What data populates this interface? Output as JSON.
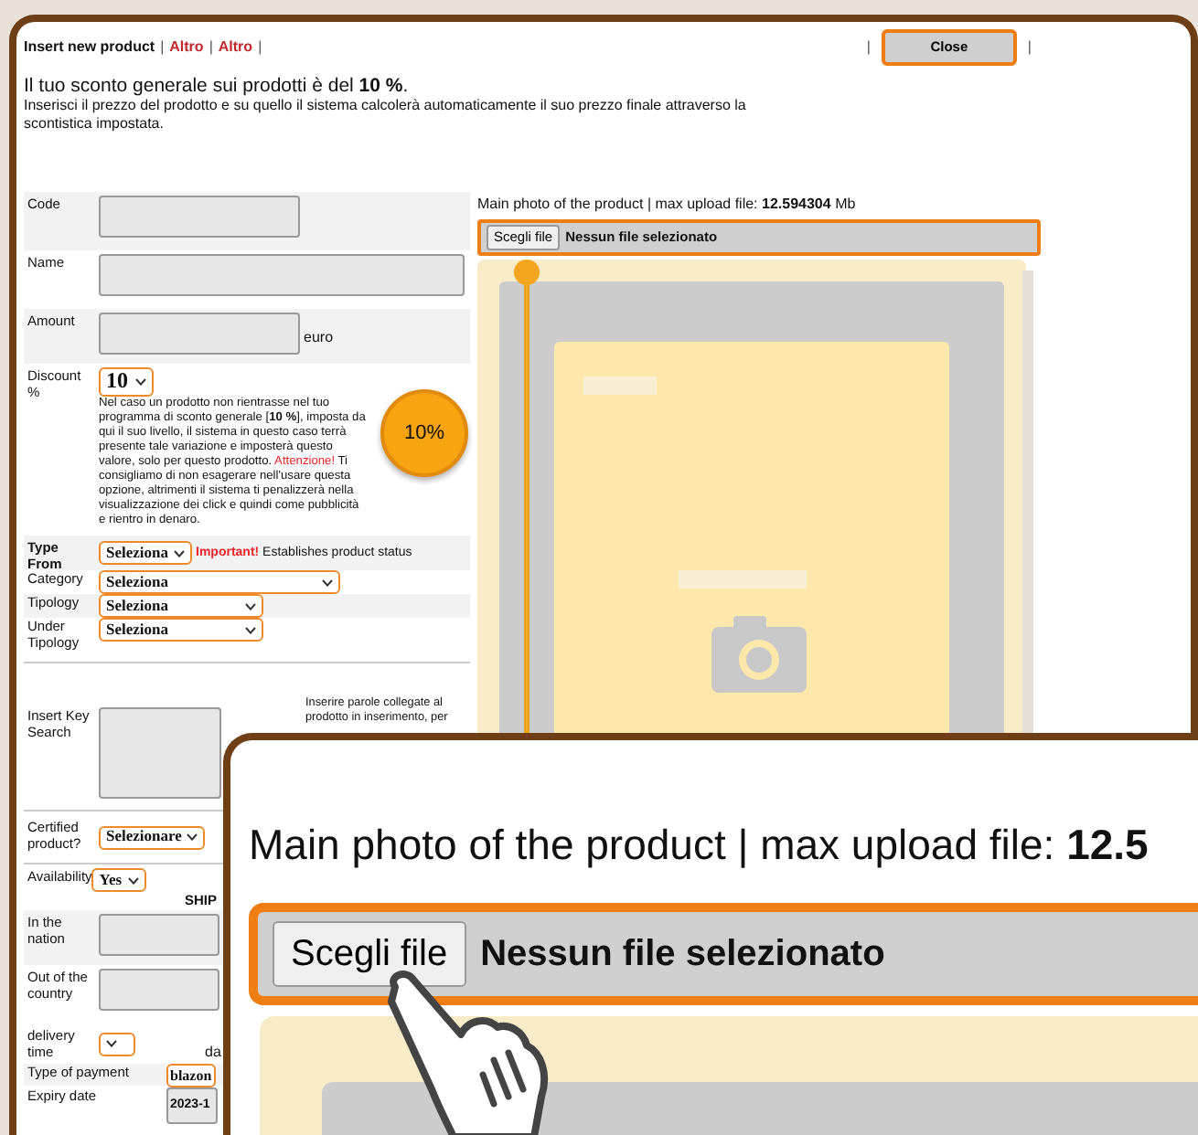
{
  "header": {
    "title": "Insert new product",
    "links": [
      "Altro",
      "Altro"
    ],
    "separators": [
      "|",
      "|",
      "|",
      "|",
      "|"
    ],
    "close_button": "Close"
  },
  "intro": {
    "headline": "Il tuo sconto generale sui prodotti è del **10 %**.",
    "text": "Inserisci il prezzo del prodotto e su quello il sistema calcolerà automaticamente il suo prezzo finale attraverso la scontistica impostata."
  },
  "code": {
    "label": "Code"
  },
  "name": {
    "label": "Name"
  },
  "amount": {
    "label": "Amount",
    "unit": "euro"
  },
  "discount": {
    "label": "Discount %",
    "value": "10",
    "help": "Nel caso un prodotto non rientrasse nel tuo programma di sconto generale [**10 %**], imposta da qui il suo livello, il sistema in questo caso terrà presente tale variazione e imposterà questo valore, solo per questo prodotto.",
    "warning": "Attenzione!",
    "warning_text": "Ti consigliamo di non esagerare nell'usare questa opzione, altrimenti il sistema ti penalizzerà nella visualizzazione dei click e quindi come pubblicità e rientro in denaro.",
    "badge": "10%"
  },
  "type_from": {
    "label": "Type From",
    "value": "Seleziona",
    "note_strong": "Important!",
    "note": "Establishes product status"
  },
  "selects": [
    {
      "label": "Category",
      "value": "Seleziona",
      "wide": true
    },
    {
      "label": "Tipology",
      "value": "Seleziona",
      "wide": false
    },
    {
      "label": "Under Tipology",
      "value": "Seleziona",
      "wide": false
    }
  ],
  "key_search": {
    "label": "Insert Key Search",
    "hint_lines": [
      "Inserire parole collegate al",
      "prodotto in inserimento, per"
    ]
  },
  "certified": {
    "label": "Certified product?",
    "value": "Selezionare"
  },
  "availability": {
    "label": "Availability",
    "value": "Yes"
  },
  "shipping": {
    "heading": "SHIP",
    "in_nation": "In the nation",
    "out_country": "Out of the country",
    "delivery_label": "delivery time",
    "delivery_after": "da"
  },
  "payment": {
    "label": "Type of payment",
    "value": "blazon"
  },
  "expiry": {
    "label": "Expiry date",
    "value": "2023-1"
  },
  "photo": {
    "label": "Main photo of the product | max upload file: **12.594304** Mb",
    "button": "Scegli file",
    "status": "Nessun file selezionato"
  },
  "callout": {
    "label": "Main photo of the product | max upload file: **12.5**",
    "button": "Scegli file",
    "status": "Nessun file selezionato"
  }
}
